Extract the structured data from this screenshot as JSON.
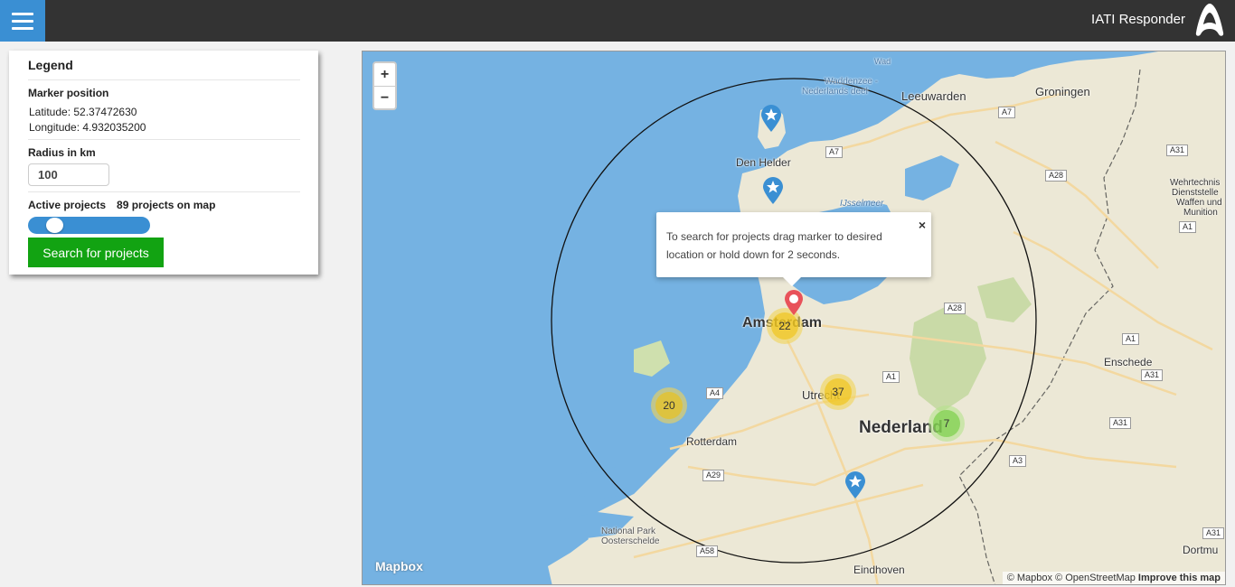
{
  "header": {
    "title": "IATI Responder"
  },
  "legend": {
    "title": "Legend",
    "marker_position_label": "Marker position",
    "latitude_text": "Latitude: 52.37472630",
    "longitude_text": "Longitude: 4.932035200",
    "radius_label": "Radius in km",
    "radius_value": "100",
    "active_projects_label": "Active projects",
    "projects_count_text": "89 projects on map",
    "active_toggle_on": true,
    "search_button": "Search for projects"
  },
  "map": {
    "zoom_in": "+",
    "zoom_out": "−",
    "popup_text": "To search for projects drag marker to desired location or hold down for 2 seconds.",
    "popup_close": "×",
    "clusters": [
      {
        "count": "22",
        "color": "yellow"
      },
      {
        "count": "37",
        "color": "yellow"
      },
      {
        "count": "20",
        "color": "yellow"
      },
      {
        "count": "7",
        "color": "green"
      }
    ],
    "labels": {
      "amsterdam": "Amsterdam",
      "utrecht": "Utrecht",
      "rotterdam": "Rotterdam",
      "nederland": "Nederland",
      "den_helder": "Den Helder",
      "leeuwarden": "Leeuwarden",
      "groningen": "Groningen",
      "enschede": "Enschede",
      "eindhoven": "Eindhoven",
      "waddenzee": "Waddenzee -",
      "waddenzee2": "Nederlands deel",
      "ijsselmeer": "IJsselmeer",
      "national_park": "National Park",
      "oosterschelde": "Oosterschelde",
      "dortmund": "Dortmu",
      "wehr1": "Wehrtechnis",
      "wehr2": "Dienststelle",
      "wehr3": "Waffen und",
      "wehr4": "Munition",
      "wad": "Wad"
    },
    "roads": [
      "A7",
      "A7",
      "A31",
      "A28",
      "A28",
      "A1",
      "A1",
      "A31",
      "A31",
      "A4",
      "A29",
      "A3",
      "A58",
      "A31",
      "A1"
    ],
    "mapbox_logo": "Mapbox",
    "attribution_1": "© Mapbox © OpenStreetMap",
    "attribution_2": "Improve this map",
    "colors": {
      "water": "#75b2e2",
      "land": "#ece8d6",
      "cluster_yellow": "#f0c20c",
      "cluster_green": "#6ecc39",
      "star_marker": "#3a8fd3",
      "position_marker": "#e8525a"
    }
  }
}
